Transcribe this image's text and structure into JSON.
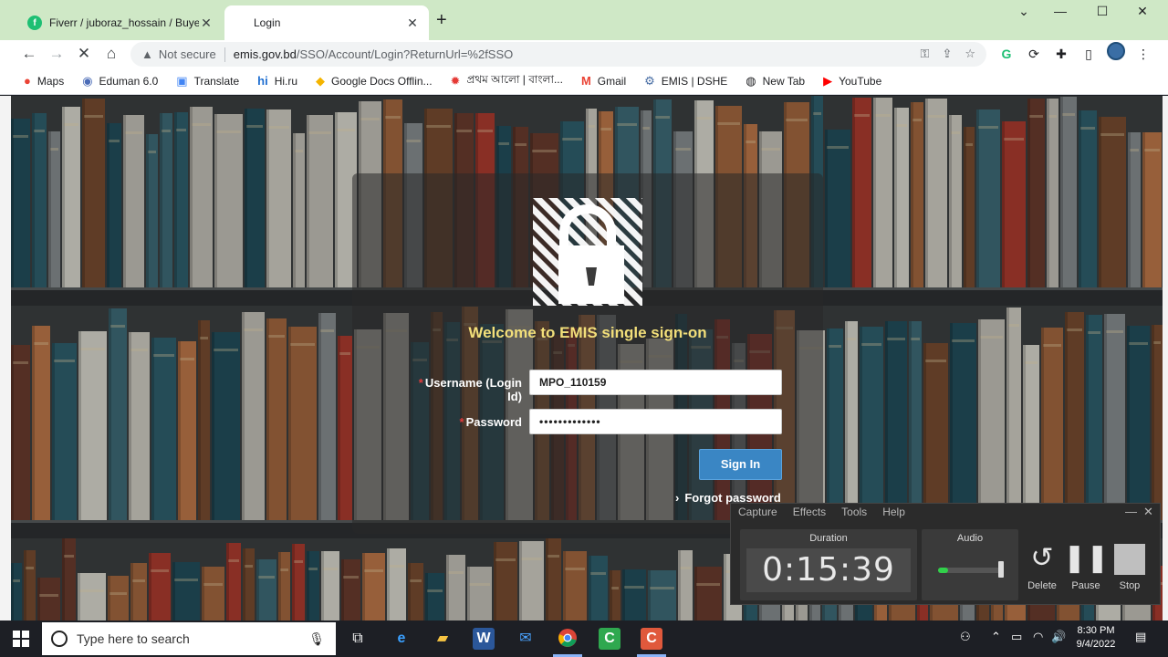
{
  "browser": {
    "tabs": [
      {
        "title": "Fiverr / juboraz_hossain / Buyer R",
        "favicon": "fiverr-icon",
        "active": false
      },
      {
        "title": "Login",
        "favicon": "",
        "active": true
      }
    ],
    "address": {
      "security": "Not secure",
      "host": "emis.gov.bd",
      "path": "/SSO/Account/Login?ReturnUrl=%2fSSO"
    },
    "bookmarks": [
      {
        "label": "Maps",
        "icon": "maps-pin-icon",
        "color": "#ea4335"
      },
      {
        "label": "Eduman 6.0",
        "icon": "eduman-icon",
        "color": "#4b6cb7"
      },
      {
        "label": "Translate",
        "icon": "translate-icon",
        "color": "#4285f4"
      },
      {
        "label": "Hi.ru",
        "icon": "hi-icon",
        "color": "#1f6fd1"
      },
      {
        "label": "Google Docs Offlin...",
        "icon": "docs-icon",
        "color": "#f4b400"
      },
      {
        "label": "প্রথম আলো | বাংলা...",
        "icon": "prothom-alo-icon",
        "color": "#e53935"
      },
      {
        "label": "Gmail",
        "icon": "gmail-icon",
        "color": "#ea4335"
      },
      {
        "label": "EMIS | DSHE",
        "icon": "emis-icon",
        "color": "#4a6fa5"
      },
      {
        "label": "New Tab",
        "icon": "new-tab-icon",
        "color": "#202124"
      },
      {
        "label": "YouTube",
        "icon": "youtube-icon",
        "color": "#ff0000"
      }
    ]
  },
  "login": {
    "welcome": "Welcome to EMIS single sign-on",
    "username_label": "Username (Login Id)",
    "username_value": "MPO_110159",
    "password_label": "Password",
    "password_value": "•••••••••••••",
    "signin_label": "Sign In",
    "forgot_label": "Forgot password",
    "accent": "#3a86c4",
    "welcome_color": "#f2df7a"
  },
  "recorder": {
    "menu": [
      "Capture",
      "Effects",
      "Tools",
      "Help"
    ],
    "duration_title": "Duration",
    "duration": "0:15:39",
    "audio_title": "Audio",
    "audio_level": 0.15,
    "buttons": [
      {
        "label": "Delete",
        "icon": "delete-undo-icon"
      },
      {
        "label": "Pause",
        "icon": "pause-icon"
      },
      {
        "label": "Stop",
        "icon": "stop-icon"
      }
    ]
  },
  "taskbar": {
    "search_placeholder": "Type here to search",
    "time": "8:30 PM",
    "date": "9/4/2022"
  }
}
